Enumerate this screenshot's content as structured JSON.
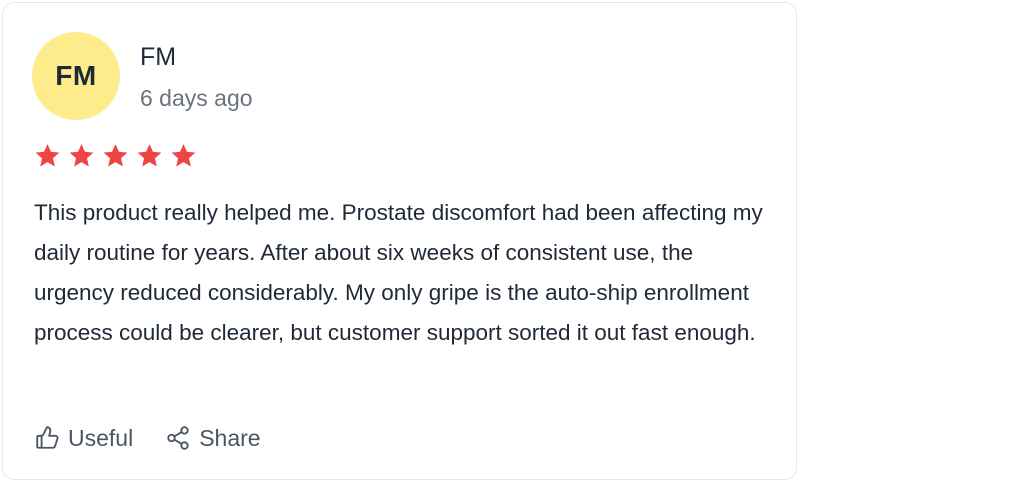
{
  "review": {
    "avatar_initials": "FM",
    "avatar_color": "#fdeb8c",
    "author": "FM",
    "time": "6 days ago",
    "rating": 5,
    "rating_max": 5,
    "star_color": "#ef4444",
    "text": "This product really helped me. Prostate discomfort had been affecting my daily routine for years. After about six weeks of consistent use, the urgency reduced considerably. My only gripe is the auto-ship enrollment process could be clearer, but customer support sorted it out fast enough."
  },
  "actions": {
    "useful_label": "Useful",
    "useful_icon": "thumbs-up-icon",
    "share_label": "Share",
    "share_icon": "share-icon"
  }
}
